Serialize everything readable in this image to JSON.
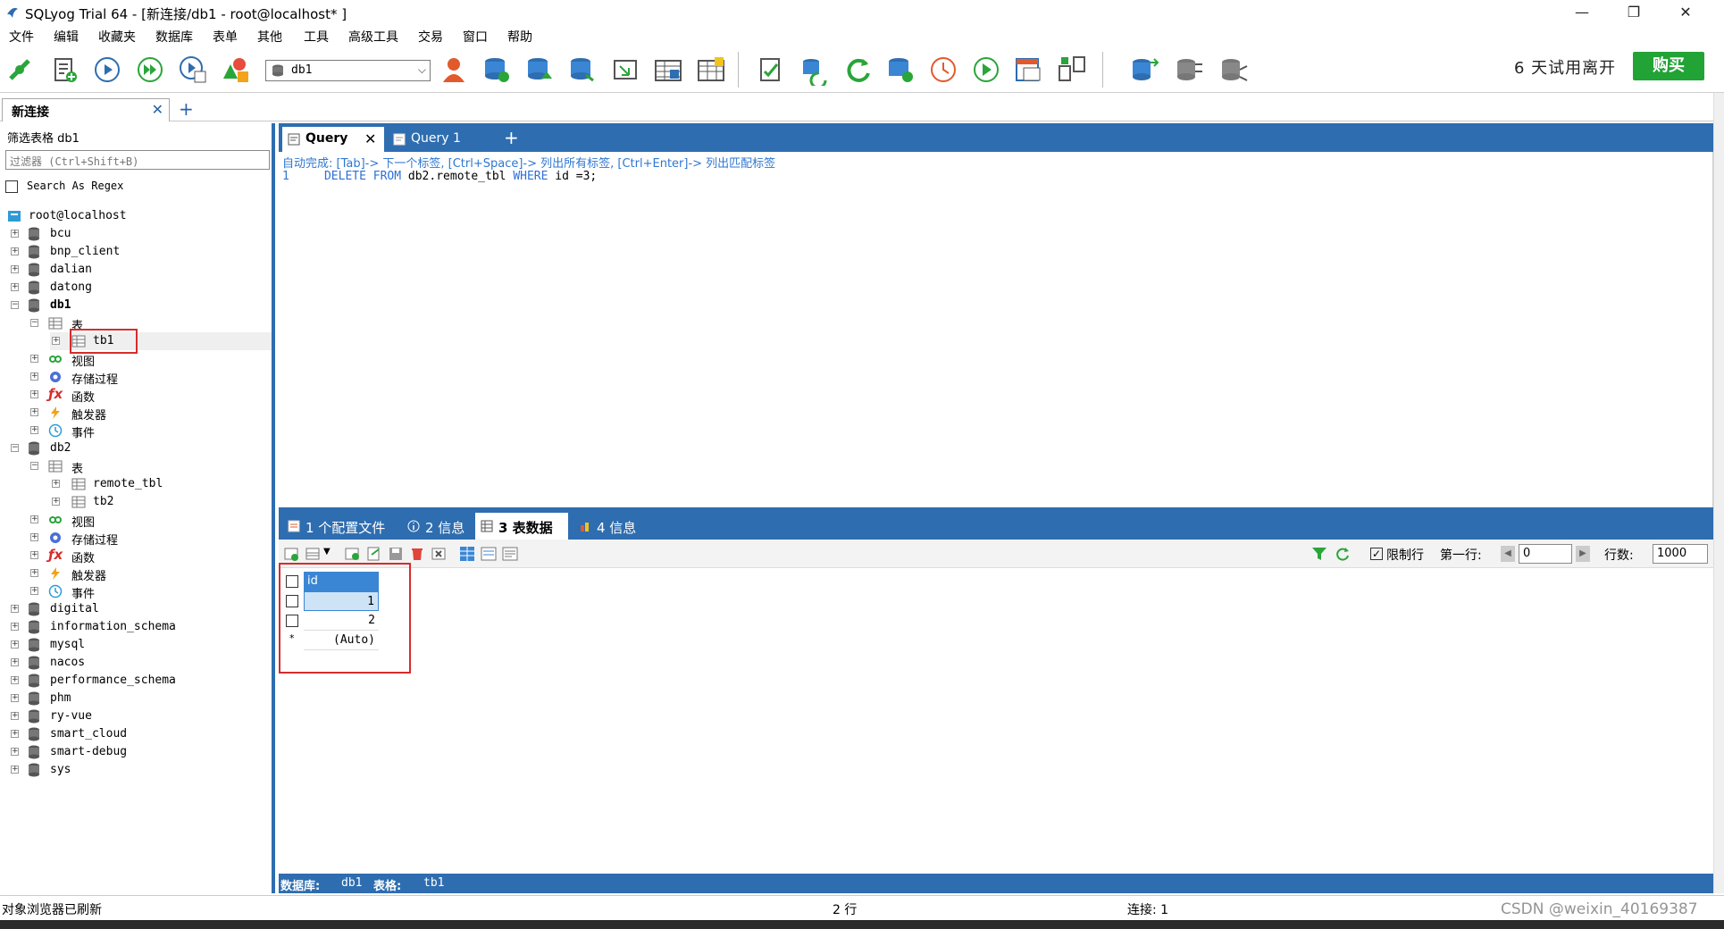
{
  "window": {
    "title": "SQLyog Trial 64 - [新连接/db1 - root@localhost* ]",
    "minimize": "—",
    "restore": "❐",
    "close": "✕"
  },
  "menu": [
    "文件",
    "编辑",
    "收藏夹",
    "数据库",
    "表单",
    "其他",
    "工具",
    "高级工具",
    "交易",
    "窗口",
    "帮助"
  ],
  "toolbar": {
    "db_selected": "db1",
    "trial_text": "6 天试用离开",
    "buy_label": "购买"
  },
  "connection_tab": {
    "label": "新连接",
    "close": "✕",
    "add": "+"
  },
  "object_browser": {
    "filter_title": "筛选表格 db1",
    "filter_placeholder": "过滤器 (Ctrl+Shift+B)",
    "regex_label": "Search As Regex",
    "root": "root@localhost",
    "tree": {
      "bcu": "bcu",
      "bnp_client": "bnp_client",
      "dalian": "dalian",
      "datong": "datong",
      "db1": "db1",
      "db1_tables": "表",
      "db1_tb1": "tb1",
      "db1_views": "视图",
      "db1_procs": "存储过程",
      "db1_funcs": "函数",
      "db1_triggers": "触发器",
      "db1_events": "事件",
      "db2": "db2",
      "db2_tables": "表",
      "db2_remote_tbl": "remote_tbl",
      "db2_tb2": "tb2",
      "db2_views": "视图",
      "db2_procs": "存储过程",
      "db2_funcs": "函数",
      "db2_triggers": "触发器",
      "db2_events": "事件",
      "digital": "digital",
      "information_schema": "information_schema",
      "mysql": "mysql",
      "nacos": "nacos",
      "performance_schema": "performance_schema",
      "phm": "phm",
      "ry_vue": "ry-vue",
      "smart_cloud": "smart_cloud",
      "smart_debug": "smart-debug",
      "sys": "sys"
    }
  },
  "editor": {
    "tabs": [
      {
        "label": "Query",
        "close": "✕"
      },
      {
        "label": "Query 1"
      }
    ],
    "add_tab": "+",
    "hint": "自动完成: [Tab]-> 下一个标签, [Ctrl+Space]-> 列出所有标签, [Ctrl+Enter]-> 列出匹配标签",
    "line_no": "1",
    "code": {
      "kw1": "DELETE",
      "kw2": "FROM",
      "table": "db2.remote_tbl",
      "kw3": "WHERE",
      "cond": "id =3;"
    }
  },
  "results": {
    "tabs": {
      "profile": "1 个配置文件",
      "info": "2 信息",
      "table_data": "3 表数据",
      "info4": "4 信息"
    },
    "limit_label": "限制行",
    "first_row_label": "第一行:",
    "first_row_value": "0",
    "rows_label": "行数:",
    "rows_value": "1000",
    "column": "id",
    "rows": [
      "1",
      "2"
    ],
    "new_row_marker": "*",
    "new_row_value": "(Auto)"
  },
  "status_strip": {
    "db_label": "数据库:",
    "db_value": "db1",
    "table_label": "表格:",
    "table_value": "tb1"
  },
  "statusbar": {
    "left": "对象浏览器已刷新",
    "rows": "2 行",
    "conn": "连接: 1"
  },
  "watermark": "CSDN @weixin_40169387",
  "colors": {
    "accent_blue": "#2e6db0",
    "buy_green": "#22a335",
    "highlight_red": "#d62c2c",
    "keyword_blue": "#2e6fd6"
  }
}
